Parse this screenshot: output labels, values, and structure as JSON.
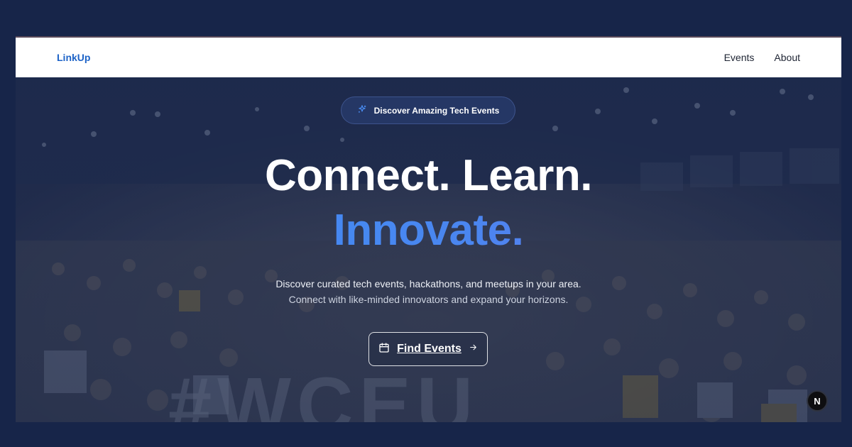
{
  "nav": {
    "brand": "LinkUp",
    "links": [
      "Events",
      "About"
    ]
  },
  "hero": {
    "badge_icon": "sparkles-icon",
    "badge_text": "Discover Amazing Tech Events",
    "headline_line1": "Connect. Learn.",
    "headline_line2": "Innovate.",
    "subtitle_line1": "Discover curated tech events, hackathons, and meetups in your area.",
    "subtitle_line2": "Connect with like-minded innovators and expand your horizons.",
    "cta_icon": "calendar-icon",
    "cta_label": "Find Events",
    "cta_arrow_icon": "arrow-right-icon"
  },
  "floating_badge": {
    "label": "N"
  },
  "colors": {
    "page_bg": "#172549",
    "brand": "#1d63c7",
    "gradient_start": "#3b8ef5",
    "gradient_end": "#7b6ee8"
  }
}
